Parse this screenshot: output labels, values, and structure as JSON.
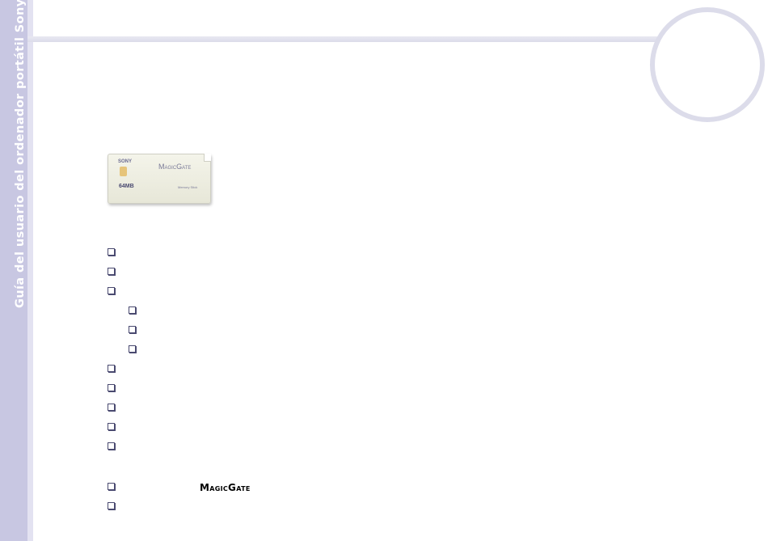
{
  "sidebar": {
    "title": "Guía del usuario del ordenador portátil Sony"
  },
  "card": {
    "brand": "SONY",
    "title": "MagicGate",
    "capacity": "64MB",
    "label": "Memory Stick"
  },
  "list": {
    "bullet_icon": "hollow-square-bullet-icon",
    "magicgate_logo": "MagicGate"
  }
}
